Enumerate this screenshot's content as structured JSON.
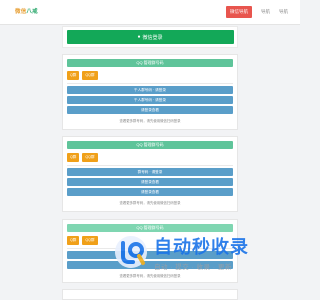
{
  "header": {
    "logo_part1": "微信",
    "logo_part2": "八戒",
    "nav": [
      {
        "label": "微信导航",
        "active": true
      },
      {
        "label": "导航",
        "active": false
      },
      {
        "label": "导航",
        "active": false
      }
    ]
  },
  "wechat_login": {
    "label": "微信登录",
    "icon": "wechat-icon"
  },
  "cards": [
    {
      "head": "QQ 管理群号码",
      "tags": [
        "Q群",
        "QQ群"
      ],
      "rows": [
        "千人群号码 · 请登录",
        "千人群号码 · 请登录",
        "请登录查看"
      ],
      "note": "查看更多群号码，请先使用微信扫码登录"
    },
    {
      "head": "QQ 管理群号码",
      "tags": [
        "Q群",
        "QQ群"
      ],
      "rows": [
        "群号码 · 请登录",
        "请登录查看",
        "请登录查看"
      ],
      "note": "查看更多群号码，请先使用微信扫码登录"
    },
    {
      "head": "QQ 管理群号码",
      "tags": [
        "Q群",
        "QQ群"
      ],
      "rows": [
        "",
        ""
      ],
      "note": "查看更多群号码，请先使用微信扫码登录"
    }
  ],
  "watermark": {
    "title": "自动秒收录",
    "subtitle": "自动 · 提交 · 收录 · 更新"
  },
  "colors": {
    "brand_green": "#13a858",
    "head_green": "#5fc49a",
    "tag_orange": "#f0a019",
    "row_blue": "#5a9ec9",
    "nav_red": "#e8554e"
  }
}
